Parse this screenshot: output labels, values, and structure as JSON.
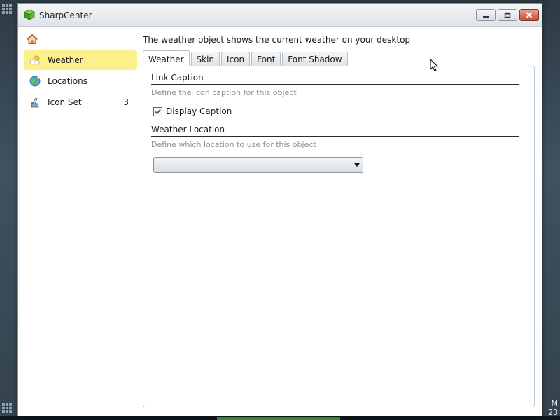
{
  "window": {
    "title": "SharpCenter"
  },
  "sidebar": {
    "items": [
      {
        "label": "",
        "icon": "home-icon",
        "count": ""
      },
      {
        "label": "Weather",
        "icon": "weather-icon",
        "count": "",
        "selected": true
      },
      {
        "label": "Locations",
        "icon": "globe-icon",
        "count": ""
      },
      {
        "label": "Icon Set",
        "icon": "icon-set-icon",
        "count": "3"
      }
    ]
  },
  "main": {
    "description": "The weather object shows the current weather on your desktop",
    "tabs": [
      {
        "label": "Weather",
        "active": true
      },
      {
        "label": "Skin"
      },
      {
        "label": "Icon"
      },
      {
        "label": "Font"
      },
      {
        "label": "Font Shadow"
      }
    ],
    "link_caption": {
      "title": "Link Caption",
      "hint": "Define the icon caption for this object",
      "checkbox_label": "Display Caption",
      "checked": true
    },
    "weather_location": {
      "title": "Weather Location",
      "hint": "Define which location to use for this object",
      "selected_value": ""
    }
  },
  "desktop": {
    "clock_line1": "M",
    "clock_line2": "23"
  },
  "colors": {
    "selected_bg": "#fbf089",
    "close_button": "#c54a34"
  }
}
